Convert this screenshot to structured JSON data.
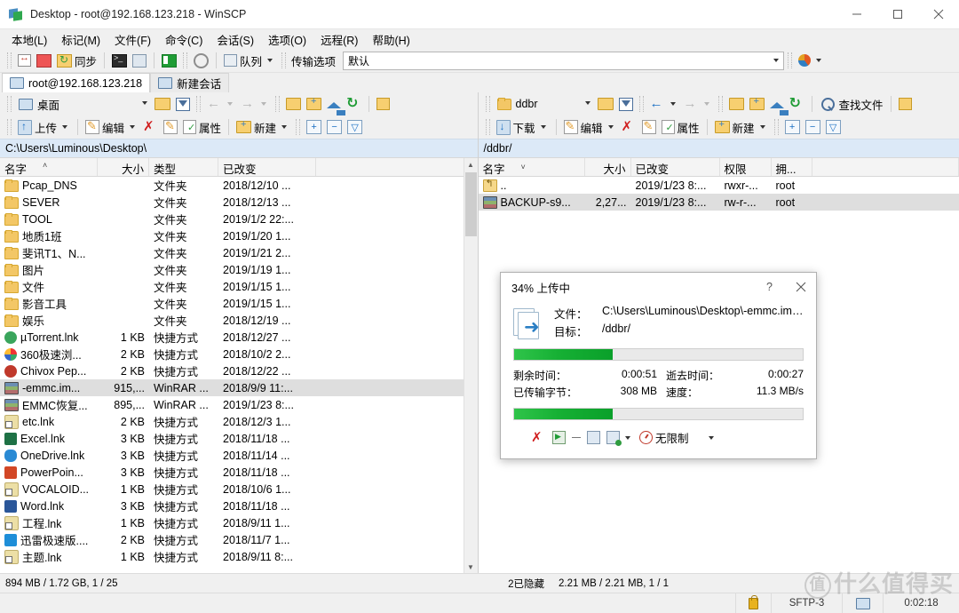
{
  "window": {
    "title": "Desktop - root@192.168.123.218 - WinSCP",
    "minimize": "—",
    "maximize": "□",
    "close": "✕"
  },
  "menubar": [
    {
      "label": "本地(L)"
    },
    {
      "label": "标记(M)"
    },
    {
      "label": "文件(F)"
    },
    {
      "label": "命令(C)"
    },
    {
      "label": "会话(S)"
    },
    {
      "label": "选项(O)"
    },
    {
      "label": "远程(R)"
    },
    {
      "label": "帮助(H)"
    }
  ],
  "toolbar": {
    "sync_label": "同步",
    "queue_label": "队列",
    "transfer_settings_label": "传输选项",
    "transfer_preset": "默认"
  },
  "tabs": [
    {
      "label": "root@192.168.123.218",
      "active": true
    },
    {
      "label": "新建会话",
      "active": false
    }
  ],
  "local": {
    "drive_label": "桌面",
    "path": "C:\\Users\\Luminous\\Desktop\\",
    "actions": {
      "upload": "上传",
      "edit": "编辑",
      "properties": "属性",
      "new": "新建"
    },
    "columns": [
      {
        "label": "名字",
        "sort": "˄"
      },
      {
        "label": "大小"
      },
      {
        "label": "类型"
      },
      {
        "label": "已改变"
      }
    ],
    "rows": [
      {
        "name": "Pcap_DNS",
        "size": "",
        "type": "文件夹",
        "changed": "2018/12/10 ...",
        "icon": "folder"
      },
      {
        "name": "SEVER",
        "size": "",
        "type": "文件夹",
        "changed": "2018/12/13 ...",
        "icon": "folder"
      },
      {
        "name": "TOOL",
        "size": "",
        "type": "文件夹",
        "changed": "2019/1/2  22:...",
        "icon": "folder"
      },
      {
        "name": "地质1班",
        "size": "",
        "type": "文件夹",
        "changed": "2019/1/20  1...",
        "icon": "folder"
      },
      {
        "name": "斐讯T1、N...",
        "size": "",
        "type": "文件夹",
        "changed": "2019/1/21  2...",
        "icon": "folder"
      },
      {
        "name": "图片",
        "size": "",
        "type": "文件夹",
        "changed": "2019/1/19  1...",
        "icon": "folder"
      },
      {
        "name": "文件",
        "size": "",
        "type": "文件夹",
        "changed": "2019/1/15  1...",
        "icon": "folder"
      },
      {
        "name": "影音工具",
        "size": "",
        "type": "文件夹",
        "changed": "2019/1/15  1...",
        "icon": "folder"
      },
      {
        "name": "娱乐",
        "size": "",
        "type": "文件夹",
        "changed": "2018/12/19 ...",
        "icon": "folder"
      },
      {
        "name": "µTorrent.lnk",
        "size": "1 KB",
        "type": "快捷方式",
        "changed": "2018/12/27 ...",
        "icon": "utorrent"
      },
      {
        "name": "360极速浏...",
        "size": "2 KB",
        "type": "快捷方式",
        "changed": "2018/10/2  2...",
        "icon": "360"
      },
      {
        "name": "Chivox Pep...",
        "size": "2 KB",
        "type": "快捷方式",
        "changed": "2018/12/22 ...",
        "icon": "chivox"
      },
      {
        "name": "-emmc.im...",
        "size": "915,...",
        "type": "WinRAR ...",
        "changed": "2018/9/9  11:...",
        "icon": "rar",
        "selected": true
      },
      {
        "name": "EMMC恢复...",
        "size": "895,...",
        "type": "WinRAR ...",
        "changed": "2019/1/23  8:...",
        "icon": "rar"
      },
      {
        "name": "etc.lnk",
        "size": "2 KB",
        "type": "快捷方式",
        "changed": "2018/12/3  1...",
        "icon": "lnk"
      },
      {
        "name": "Excel.lnk",
        "size": "3 KB",
        "type": "快捷方式",
        "changed": "2018/11/18 ...",
        "icon": "excel"
      },
      {
        "name": "OneDrive.lnk",
        "size": "3 KB",
        "type": "快捷方式",
        "changed": "2018/11/14 ...",
        "icon": "onedrive"
      },
      {
        "name": "PowerPoin...",
        "size": "3 KB",
        "type": "快捷方式",
        "changed": "2018/11/18 ...",
        "icon": "ppt"
      },
      {
        "name": "VOCALOID...",
        "size": "1 KB",
        "type": "快捷方式",
        "changed": "2018/10/6  1...",
        "icon": "lnk"
      },
      {
        "name": "Word.lnk",
        "size": "3 KB",
        "type": "快捷方式",
        "changed": "2018/11/18 ...",
        "icon": "word"
      },
      {
        "name": "工程.lnk",
        "size": "1 KB",
        "type": "快捷方式",
        "changed": "2018/9/11  1...",
        "icon": "lnk"
      },
      {
        "name": "迅雷极速版....",
        "size": "2 KB",
        "type": "快捷方式",
        "changed": "2018/11/7  1...",
        "icon": "thunder"
      },
      {
        "name": "主题.lnk",
        "size": "1 KB",
        "type": "快捷方式",
        "changed": "2018/9/11  8:...",
        "icon": "lnk"
      }
    ]
  },
  "remote": {
    "dir_label": "ddbr",
    "path": "/ddbr/",
    "find_files": "查找文件",
    "actions": {
      "download": "下载",
      "edit": "编辑",
      "properties": "属性",
      "new": "新建"
    },
    "columns": [
      {
        "label": "名字",
        "sort": "˅"
      },
      {
        "label": "大小"
      },
      {
        "label": "已改变"
      },
      {
        "label": "权限"
      },
      {
        "label": "拥..."
      }
    ],
    "rows": [
      {
        "name": "..",
        "size": "",
        "changed": "2019/1/23 8:...",
        "perm": "rwxr-...",
        "owner": "root",
        "icon": "updir"
      },
      {
        "name": "BACKUP-s9...",
        "size": "2,27...",
        "changed": "2019/1/23 8:...",
        "perm": "rw-r-...",
        "owner": "root",
        "icon": "rar",
        "selected": true
      }
    ]
  },
  "statusbar": {
    "local_summary": "894 MB / 1.72 GB,  1 / 25",
    "hidden_count": "2已隐藏",
    "remote_summary": "2.21 MB / 2.21 MB,  1 / 1",
    "protocol": "SFTP-3",
    "session_time": "0:02:18"
  },
  "dialog": {
    "title": "34% 上传中",
    "help_btn": "?",
    "close_btn": "✕",
    "file_label": "文件：",
    "file_value": "C:\\Users\\Luminous\\Desktop\\-emmc.img.gz",
    "target_label": "目标：",
    "target_value": "/ddbr/",
    "progress_percent": 34,
    "time_left_label": "剩余时间：",
    "time_left_value": "0:00:51",
    "time_elapsed_label": "逝去时间：",
    "time_elapsed_value": "0:00:27",
    "bytes_label": "已传输字节：",
    "bytes_value": "308 MB",
    "speed_label": "速度：",
    "speed_value": "11.3 MB/s",
    "overall_percent": 34,
    "speed_limit_label": "无限制"
  },
  "watermark": {
    "badge": "值",
    "text": "什么值得买"
  },
  "colors": {
    "progress_green": "#16b034",
    "path_bar_blue": "#dce9f7",
    "selection_gray": "#dedede",
    "folder_yellow": "#f3c766"
  }
}
